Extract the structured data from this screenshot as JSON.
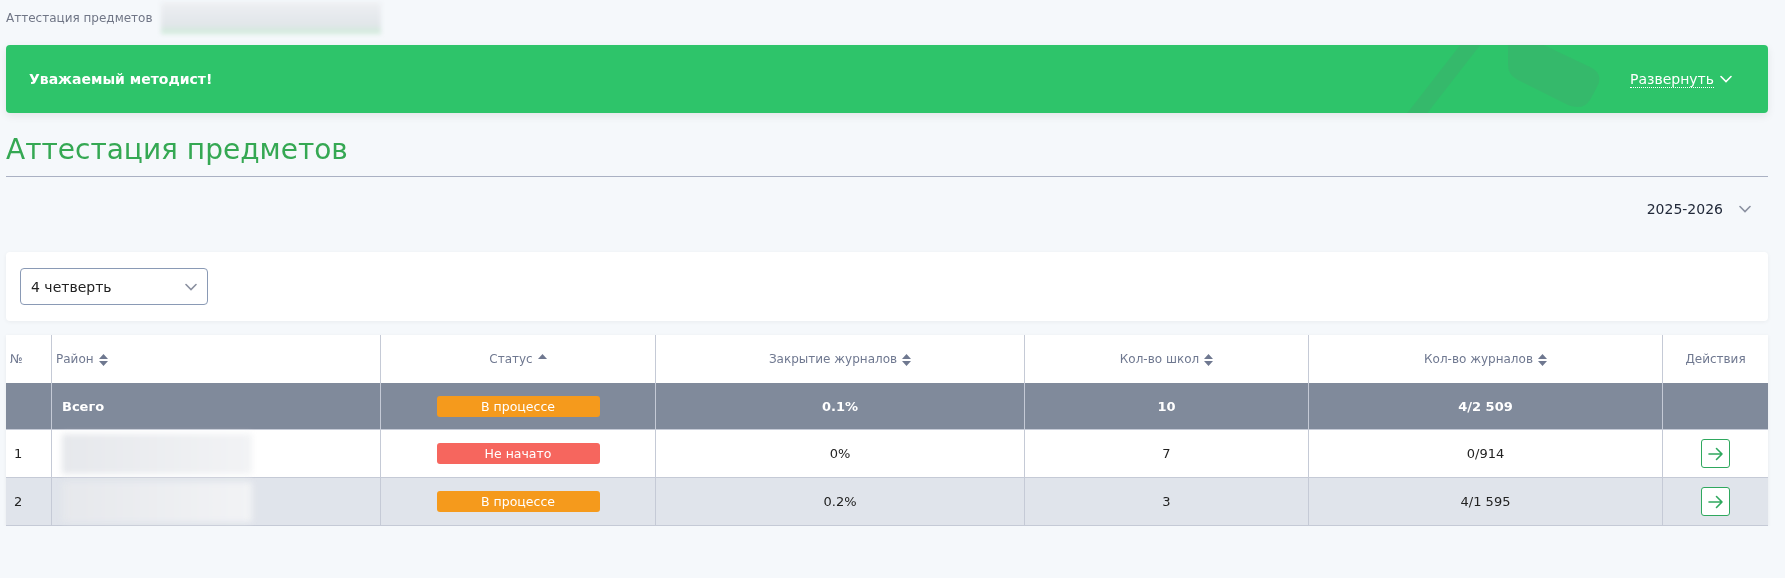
{
  "breadcrumb": {
    "label": "Аттестация предметов"
  },
  "banner": {
    "greeting": "Уважаемый методист!",
    "toggle": "Развернуть",
    "expanded": false
  },
  "page_title": "Аттестация предметов",
  "year_select": {
    "value": "2025-2026"
  },
  "period_select": {
    "value": "4 четверть"
  },
  "table": {
    "columns": [
      {
        "label": "№",
        "sortable": false,
        "sorted": false
      },
      {
        "label": "Район",
        "sortable": true,
        "sorted": false
      },
      {
        "label": "Статус",
        "sortable": true,
        "sorted": true
      },
      {
        "label": "Закрытие журналов",
        "sortable": true,
        "sorted": false
      },
      {
        "label": "Кол-во школ",
        "sortable": true,
        "sorted": false
      },
      {
        "label": "Кол-во журналов",
        "sortable": true,
        "sorted": false
      },
      {
        "label": "Действия",
        "sortable": false,
        "sorted": false
      }
    ],
    "total": {
      "label": "Всего",
      "status": {
        "text": "В процессе",
        "color": "#f59a1c"
      },
      "closing": "0.1%",
      "schools": "10",
      "journals": "4/2 509"
    },
    "rows": [
      {
        "number": "1",
        "status": {
          "text": "Не начато",
          "color": "#f6665e"
        },
        "closing": "0%",
        "schools": "7",
        "journals": "0/914",
        "shaded": false
      },
      {
        "number": "2",
        "status": {
          "text": "В процессе",
          "color": "#f59a1c"
        },
        "closing": "0.2%",
        "schools": "3",
        "journals": "4/1 595",
        "shaded": true
      }
    ]
  }
}
